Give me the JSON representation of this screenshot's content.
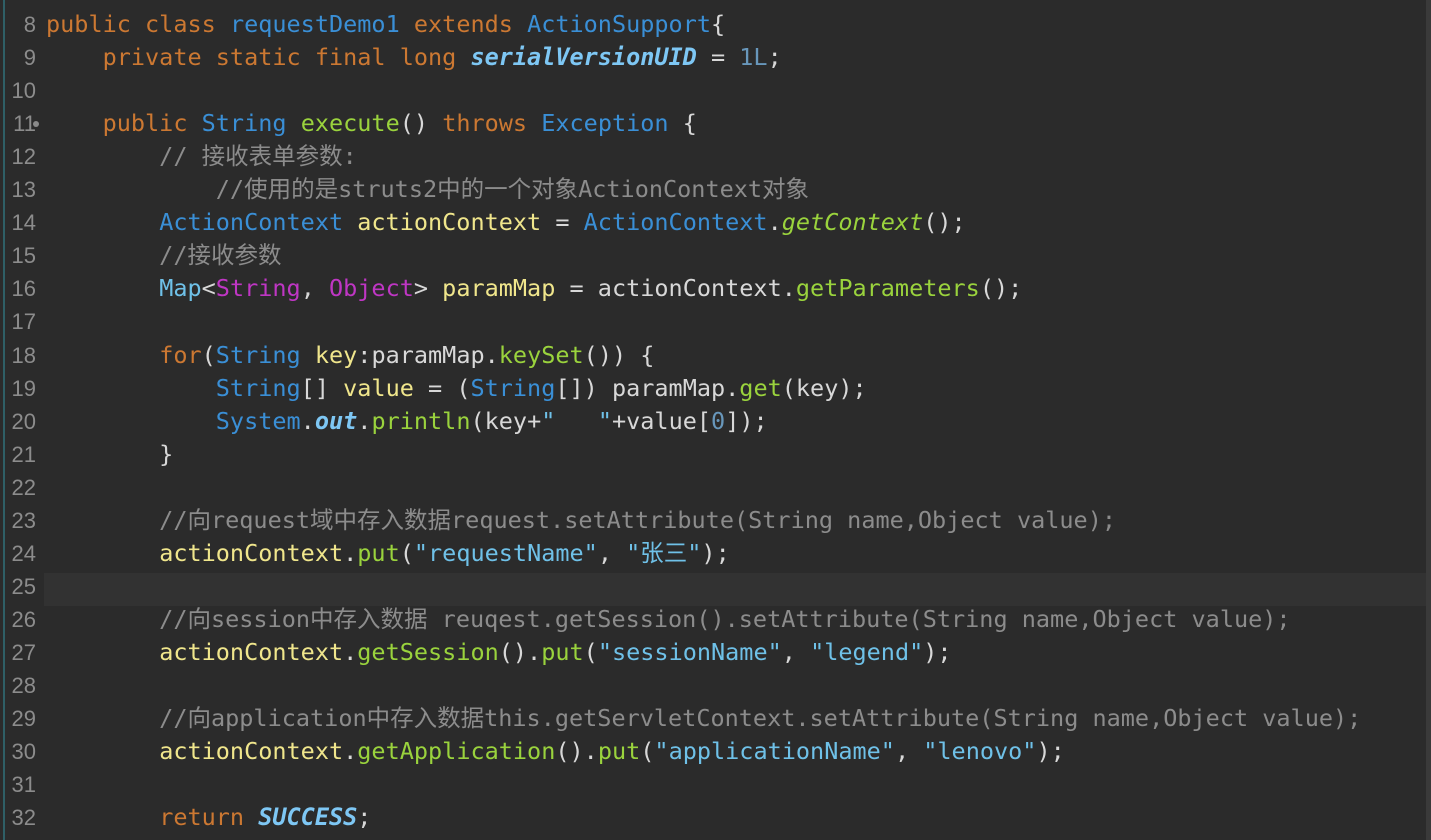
{
  "editor": {
    "lines": [
      {
        "n": "8",
        "fold": false,
        "t": [
          [
            "kw",
            "public class "
          ],
          [
            "ty",
            "requestDemo1 "
          ],
          [
            "kw",
            "extends "
          ],
          [
            "ty",
            "ActionSupport"
          ],
          [
            "pn",
            "{"
          ]
        ]
      },
      {
        "n": "9",
        "fold": false,
        "t": [
          [
            "pn",
            "    "
          ],
          [
            "kw",
            "private static final long "
          ],
          [
            "fld",
            "serialVersionUID"
          ],
          [
            "pn",
            " = "
          ],
          [
            "num",
            "1L"
          ],
          [
            "pn",
            ";"
          ]
        ]
      },
      {
        "n": "10",
        "fold": false,
        "t": []
      },
      {
        "n": "11",
        "fold": true,
        "t": [
          [
            "pn",
            "    "
          ],
          [
            "kw",
            "public "
          ],
          [
            "ty",
            "String "
          ],
          [
            "fn",
            "execute"
          ],
          [
            "pn",
            "() "
          ],
          [
            "kw",
            "throws "
          ],
          [
            "ty",
            "Exception "
          ],
          [
            "pn",
            "{"
          ]
        ]
      },
      {
        "n": "12",
        "fold": false,
        "t": [
          [
            "cm",
            "        // 接收表单参数:"
          ]
        ]
      },
      {
        "n": "13",
        "fold": false,
        "t": [
          [
            "cm",
            "            //使用的是struts2中的一个对象ActionContext对象"
          ]
        ]
      },
      {
        "n": "14",
        "fold": false,
        "t": [
          [
            "pn",
            "        "
          ],
          [
            "ty",
            "ActionContext "
          ],
          [
            "var",
            "actionContext"
          ],
          [
            "pn",
            " = "
          ],
          [
            "ty",
            "ActionContext"
          ],
          [
            "pn",
            "."
          ],
          [
            "sfn",
            "getContext"
          ],
          [
            "pn",
            "();"
          ]
        ]
      },
      {
        "n": "15",
        "fold": false,
        "t": [
          [
            "cm",
            "        //接收参数"
          ]
        ]
      },
      {
        "n": "16",
        "fold": false,
        "t": [
          [
            "pn",
            "        "
          ],
          [
            "str",
            "Map"
          ],
          [
            "pn",
            "<"
          ],
          [
            "tyt",
            "String"
          ],
          [
            "pn",
            ", "
          ],
          [
            "tyt",
            "Object"
          ],
          [
            "pn",
            "> "
          ],
          [
            "var",
            "paramMap"
          ],
          [
            "pn",
            " = actionContext."
          ],
          [
            "fn",
            "getParameters"
          ],
          [
            "pn",
            "();"
          ]
        ]
      },
      {
        "n": "17",
        "fold": false,
        "t": []
      },
      {
        "n": "18",
        "fold": false,
        "t": [
          [
            "pn",
            "        "
          ],
          [
            "kw",
            "for"
          ],
          [
            "pn",
            "("
          ],
          [
            "ty",
            "String "
          ],
          [
            "var",
            "key"
          ],
          [
            "pn",
            ":paramMap."
          ],
          [
            "fn",
            "keySet"
          ],
          [
            "pn",
            "()) {"
          ]
        ]
      },
      {
        "n": "19",
        "fold": false,
        "t": [
          [
            "pn",
            "            "
          ],
          [
            "ty",
            "String"
          ],
          [
            "pn",
            "[] "
          ],
          [
            "var",
            "value"
          ],
          [
            "pn",
            " = ("
          ],
          [
            "ty",
            "String"
          ],
          [
            "pn",
            "[]) paramMap."
          ],
          [
            "fn",
            "get"
          ],
          [
            "pn",
            "(key);"
          ]
        ]
      },
      {
        "n": "20",
        "fold": false,
        "t": [
          [
            "pn",
            "            "
          ],
          [
            "ty",
            "System"
          ],
          [
            "pn",
            "."
          ],
          [
            "fld",
            "out"
          ],
          [
            "pn",
            "."
          ],
          [
            "fn",
            "println"
          ],
          [
            "pn",
            "(key+"
          ],
          [
            "str",
            "\"   \""
          ],
          [
            "pn",
            "+value["
          ],
          [
            "num",
            "0"
          ],
          [
            "pn",
            "]);"
          ]
        ]
      },
      {
        "n": "21",
        "fold": false,
        "t": [
          [
            "pn",
            "        }"
          ]
        ]
      },
      {
        "n": "22",
        "fold": false,
        "t": []
      },
      {
        "n": "23",
        "fold": false,
        "t": [
          [
            "cm",
            "        //向request域中存入数据request.setAttribute(String name,Object value);"
          ]
        ]
      },
      {
        "n": "24",
        "fold": false,
        "t": [
          [
            "pn",
            "        "
          ],
          [
            "var",
            "actionContext"
          ],
          [
            "pn",
            "."
          ],
          [
            "fn",
            "put"
          ],
          [
            "pn",
            "("
          ],
          [
            "str",
            "\"requestName\""
          ],
          [
            "pn",
            ", "
          ],
          [
            "str",
            "\"张三\""
          ],
          [
            "pn",
            ");"
          ]
        ]
      },
      {
        "n": "25",
        "fold": false,
        "t": []
      },
      {
        "n": "26",
        "fold": false,
        "t": [
          [
            "cm",
            "        //向session中存入数据 reuqest.getSession().setAttribute(String name,Object value);"
          ]
        ]
      },
      {
        "n": "27",
        "fold": false,
        "t": [
          [
            "pn",
            "        "
          ],
          [
            "var",
            "actionContext"
          ],
          [
            "pn",
            "."
          ],
          [
            "fn",
            "getSession"
          ],
          [
            "pn",
            "()."
          ],
          [
            "fn",
            "put"
          ],
          [
            "pn",
            "("
          ],
          [
            "str",
            "\"sessionName\""
          ],
          [
            "pn",
            ", "
          ],
          [
            "str",
            "\"legend\""
          ],
          [
            "pn",
            ");"
          ]
        ]
      },
      {
        "n": "28",
        "fold": false,
        "t": []
      },
      {
        "n": "29",
        "fold": false,
        "t": [
          [
            "cm",
            "        //向application中存入数据this.getServletContext.setAttribute(String name,Object value);"
          ]
        ]
      },
      {
        "n": "30",
        "fold": false,
        "t": [
          [
            "pn",
            "        "
          ],
          [
            "var",
            "actionContext"
          ],
          [
            "pn",
            "."
          ],
          [
            "fn",
            "getApplication"
          ],
          [
            "pn",
            "()."
          ],
          [
            "fn",
            "put"
          ],
          [
            "pn",
            "("
          ],
          [
            "str",
            "\"applicationName\""
          ],
          [
            "pn",
            ", "
          ],
          [
            "str",
            "\"lenovo\""
          ],
          [
            "pn",
            ");"
          ]
        ]
      },
      {
        "n": "31",
        "fold": false,
        "t": []
      },
      {
        "n": "32",
        "fold": false,
        "t": [
          [
            "pn",
            "        "
          ],
          [
            "kw",
            "return "
          ],
          [
            "fld",
            "SUCCESS"
          ],
          [
            "pn",
            ";"
          ]
        ]
      }
    ]
  }
}
